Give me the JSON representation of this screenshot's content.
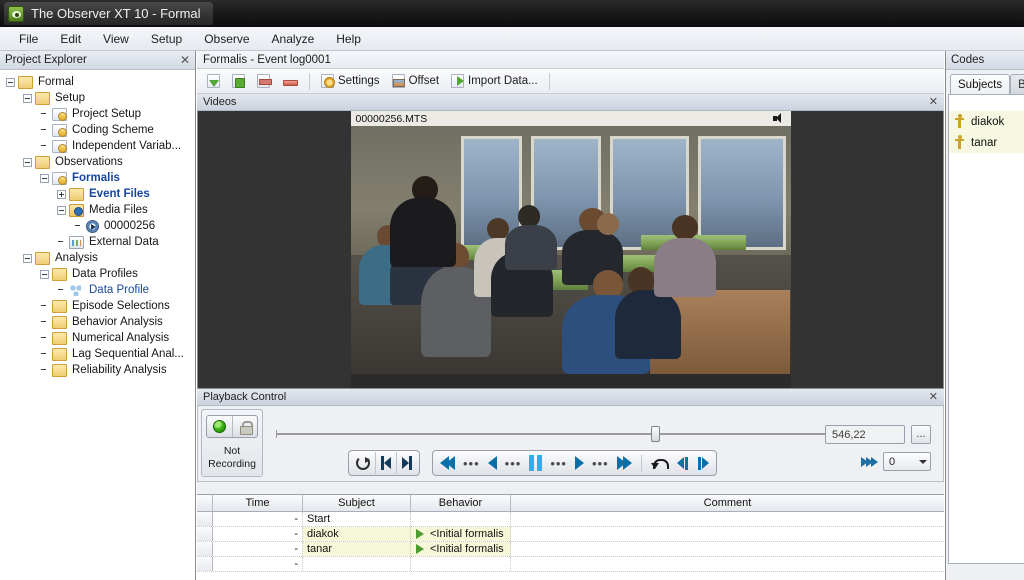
{
  "window": {
    "title": "The Observer XT 10 - Formal",
    "app_icon": "observer-app-icon"
  },
  "menu": {
    "items": [
      "File",
      "Edit",
      "View",
      "Setup",
      "Observe",
      "Analyze",
      "Help"
    ]
  },
  "project_explorer": {
    "title": "Project Explorer",
    "close": "✕",
    "tree": [
      {
        "label": "Formal",
        "depth": 0,
        "icon": "folder",
        "expander": "minus",
        "style": "normal"
      },
      {
        "label": "Setup",
        "depth": 1,
        "icon": "folder",
        "expander": "minus",
        "style": "normal"
      },
      {
        "label": "Project Setup",
        "depth": 2,
        "icon": "doc",
        "expander": "none",
        "style": "normal"
      },
      {
        "label": "Coding Scheme",
        "depth": 2,
        "icon": "doc",
        "expander": "none",
        "style": "normal"
      },
      {
        "label": "Independent Variab...",
        "depth": 2,
        "icon": "doc",
        "expander": "none",
        "style": "normal"
      },
      {
        "label": "Observations",
        "depth": 1,
        "icon": "folder",
        "expander": "minus",
        "style": "normal"
      },
      {
        "label": "Formalis",
        "depth": 2,
        "icon": "doc",
        "expander": "minus",
        "style": "bold-blue"
      },
      {
        "label": "Event Files",
        "depth": 3,
        "icon": "folder",
        "expander": "plus",
        "style": "bold-blue"
      },
      {
        "label": "Media Files",
        "depth": 3,
        "icon": "media",
        "expander": "minus",
        "style": "normal"
      },
      {
        "label": "00000256",
        "depth": 4,
        "icon": "clip",
        "expander": "none",
        "style": "normal"
      },
      {
        "label": "External Data",
        "depth": 3,
        "icon": "graph",
        "expander": "none",
        "style": "normal"
      },
      {
        "label": "Analysis",
        "depth": 1,
        "icon": "folder",
        "expander": "minus",
        "style": "normal"
      },
      {
        "label": "Data Profiles",
        "depth": 2,
        "icon": "folder",
        "expander": "minus",
        "style": "normal"
      },
      {
        "label": "Data Profile",
        "depth": 3,
        "icon": "profile",
        "expander": "none",
        "style": "blue"
      },
      {
        "label": "Episode Selections",
        "depth": 2,
        "icon": "folder",
        "expander": "none",
        "style": "normal"
      },
      {
        "label": "Behavior Analysis",
        "depth": 2,
        "icon": "folder",
        "expander": "none",
        "style": "normal"
      },
      {
        "label": "Numerical Analysis",
        "depth": 2,
        "icon": "folder",
        "expander": "none",
        "style": "normal"
      },
      {
        "label": "Lag Sequential Anal...",
        "depth": 2,
        "icon": "folder",
        "expander": "none",
        "style": "normal"
      },
      {
        "label": "Reliability Analysis",
        "depth": 2,
        "icon": "folder",
        "expander": "none",
        "style": "normal"
      }
    ]
  },
  "document": {
    "tab_label": "Formalis - Event log0001"
  },
  "toolbar": {
    "icon_buttons": [
      "export-down-icon",
      "add-page-icon",
      "print-icon",
      "delete-row-icon"
    ],
    "settings_label": "Settings",
    "offset_label": "Offset",
    "import_label": "Import Data..."
  },
  "videos_pane": {
    "title": "Videos",
    "close": "✕",
    "video_file": "00000256.MTS",
    "speaker_icon": "speaker-icon"
  },
  "playback": {
    "title": "Playback Control",
    "close": "✕",
    "record_status": "Not Recording",
    "record_dot_color": "#3cb512",
    "slider_position_pct": 69,
    "time_value": "546,22",
    "browse_label": "...",
    "speed_value": "0",
    "buttons": {
      "reset": "reset-icon",
      "prev": "previous-icon",
      "next": "next-icon",
      "rewind_fast": "rewind-fast-icon",
      "play_back": "play-backward-icon",
      "pause": "pause-icon",
      "play_forward": "play-forward-icon",
      "forward_fast": "forward-fast-icon",
      "loop": "loop-icon",
      "step_back": "step-back-icon",
      "step_forward": "step-forward-icon"
    }
  },
  "event_table": {
    "columns": [
      "",
      "Time",
      "Subject",
      "Behavior",
      "Comment"
    ],
    "rows": [
      {
        "time": "-",
        "subject": "Start",
        "behavior": "",
        "comment": "",
        "highlight": false,
        "has_play": false
      },
      {
        "time": "-",
        "subject": "diakok",
        "behavior": "<Initial formalis",
        "comment": "",
        "highlight": true,
        "has_play": true
      },
      {
        "time": "-",
        "subject": "tanar",
        "behavior": "<Initial formalis",
        "comment": "",
        "highlight": true,
        "has_play": true
      },
      {
        "time": "-",
        "subject": "",
        "behavior": "",
        "comment": "",
        "highlight": false,
        "has_play": false
      }
    ]
  },
  "codes_panel": {
    "title": "Codes",
    "tabs": [
      {
        "label": "Subjects",
        "active": true
      },
      {
        "label": "B",
        "active": false
      }
    ],
    "items": [
      {
        "label": "diakok",
        "icon": "person-icon"
      },
      {
        "label": "tanar",
        "icon": "person-icon"
      }
    ]
  }
}
